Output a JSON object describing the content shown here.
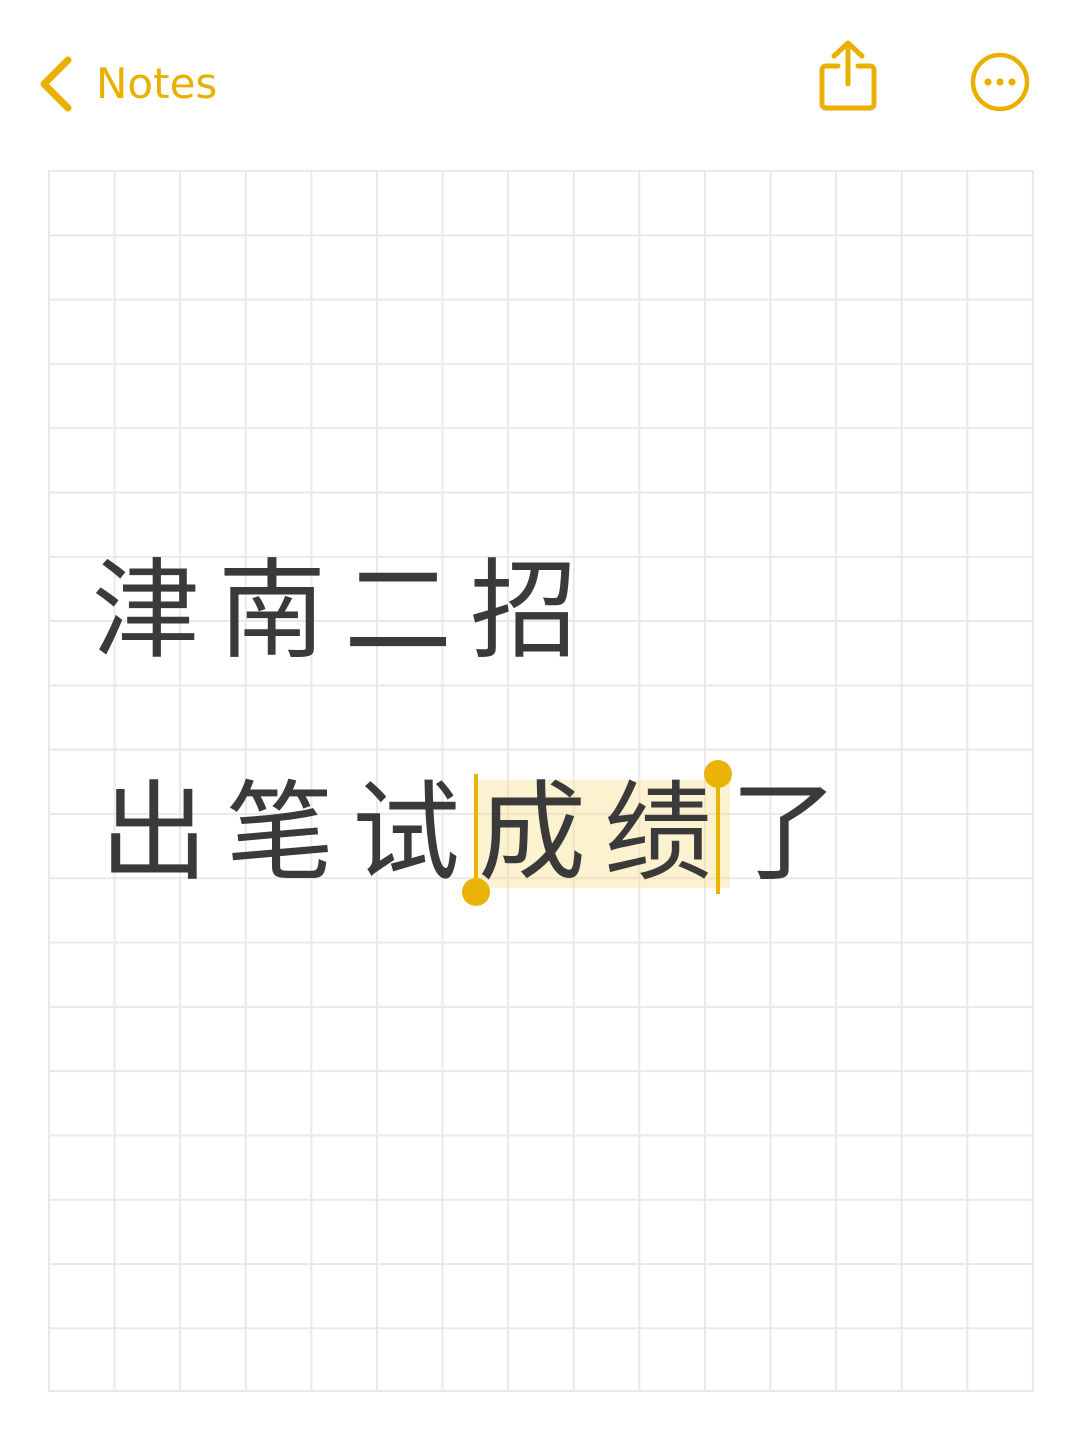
{
  "nav": {
    "back_label": "Notes",
    "back_icon": "chevron-left-icon",
    "share_icon": "share-icon",
    "more_icon": "ellipsis-circle-icon"
  },
  "note": {
    "line1": "津南二招",
    "line2_before": "出笔试",
    "line2_selected": "成绩",
    "line2_after": "了"
  },
  "colors": {
    "accent": "#E9B000",
    "text": "#3a3a3a",
    "grid": "#e9e9ec",
    "selection": "#FBEFC8"
  }
}
